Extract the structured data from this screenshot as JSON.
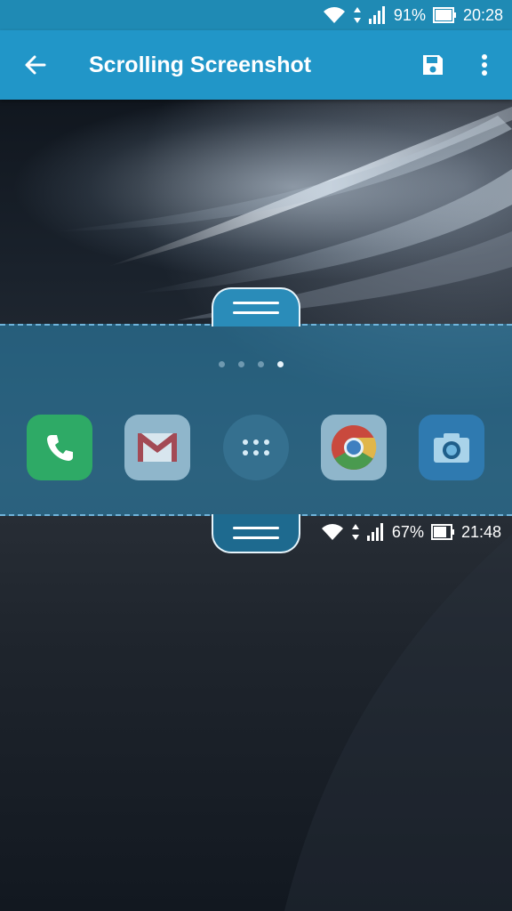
{
  "status_bar": {
    "battery_percent": "91%",
    "time": "20:28"
  },
  "app_bar": {
    "title": "Scrolling Screenshot",
    "back_icon": "arrow-back-icon",
    "save_icon": "save-icon",
    "menu_icon": "more-vert-icon"
  },
  "preview": {
    "page_indicator": {
      "count": 4,
      "active_index": 3
    },
    "dock_apps": [
      {
        "name": "Phone",
        "icon": "phone-icon"
      },
      {
        "name": "Gmail",
        "icon": "gmail-icon"
      },
      {
        "name": "App drawer",
        "icon": "app-drawer-icon"
      },
      {
        "name": "Chrome",
        "icon": "chrome-icon"
      },
      {
        "name": "Camera",
        "icon": "camera-icon"
      }
    ],
    "inner_status_bar": {
      "battery_percent": "67%",
      "time": "21:48"
    }
  },
  "colors": {
    "status_bar": "#1f8ab4",
    "app_bar": "#2196c8",
    "selection": "#2d8cb9"
  }
}
